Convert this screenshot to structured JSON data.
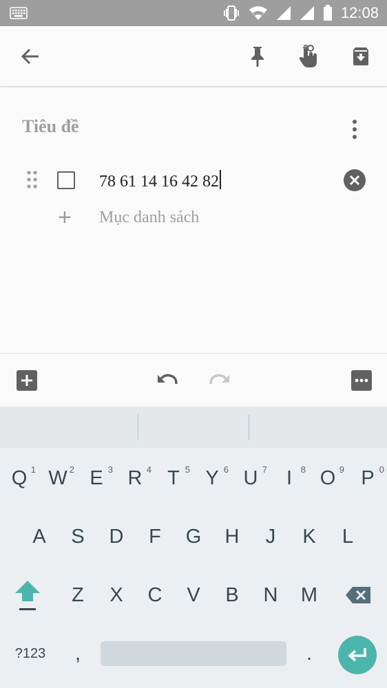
{
  "status_bar": {
    "time": "12:08",
    "icons": [
      "keyboard-icon",
      "vibrate-icon",
      "wifi-icon",
      "signal-icon",
      "signal-icon",
      "battery-icon"
    ]
  },
  "toolbar": {
    "back_icon": "arrow-back-icon",
    "pin_icon": "pin-icon",
    "reminder_icon": "reminder-icon",
    "archive_icon": "archive-icon"
  },
  "note": {
    "title_placeholder": "Tiêu đề",
    "items": [
      {
        "text": "78 61 14 16 42 82",
        "checked": false
      }
    ],
    "add_item_label": "Mục danh sách"
  },
  "bottom_bar": {
    "icons": [
      "add-box-icon",
      "undo-icon",
      "redo-icon",
      "more-horiz-icon"
    ]
  },
  "keyboard": {
    "row1": [
      "Q",
      "W",
      "E",
      "R",
      "T",
      "Y",
      "U",
      "I",
      "O",
      "P"
    ],
    "row1_hints": [
      "1",
      "2",
      "3",
      "4",
      "5",
      "6",
      "7",
      "8",
      "9",
      "0"
    ],
    "row2": [
      "A",
      "S",
      "D",
      "F",
      "G",
      "H",
      "J",
      "K",
      "L"
    ],
    "row3": [
      "Z",
      "X",
      "C",
      "V",
      "B",
      "N",
      "M"
    ],
    "symbols_label": "?123",
    "comma": ",",
    "period": "."
  },
  "colors": {
    "accent": "#4db6ac",
    "status_bar": "#9e9e9e",
    "icon": "#616161"
  }
}
